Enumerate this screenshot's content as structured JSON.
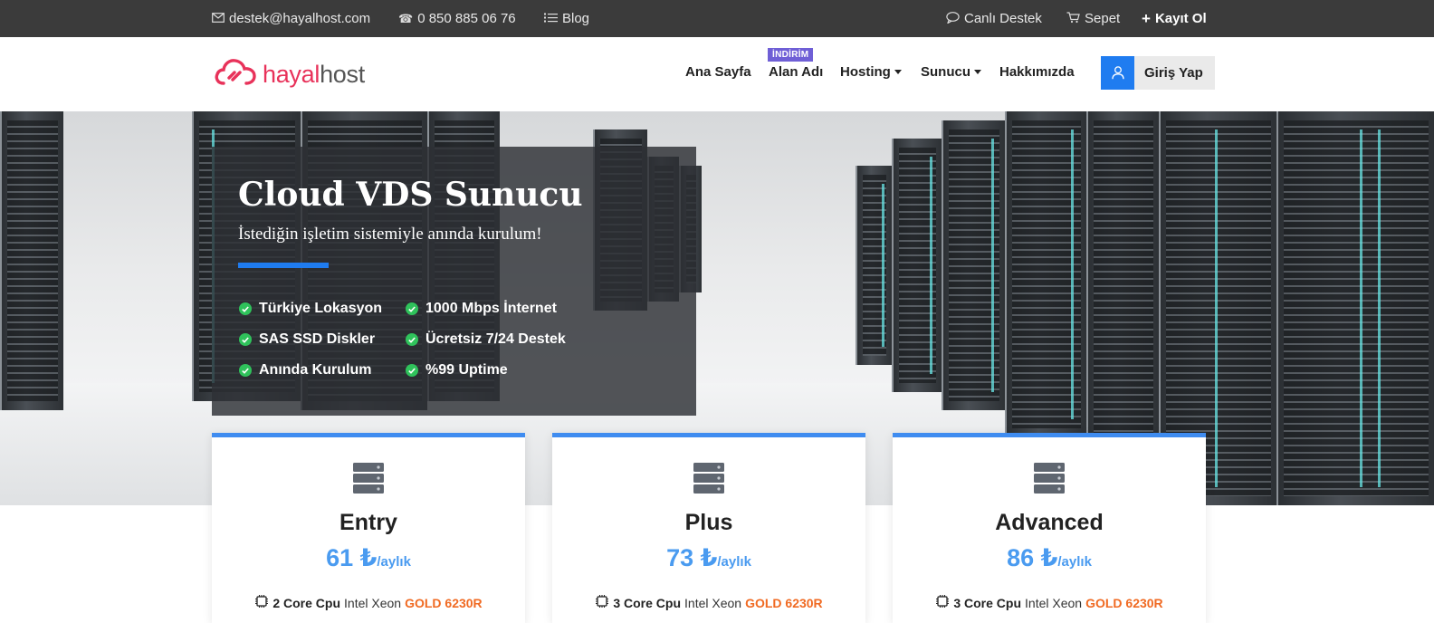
{
  "topbar": {
    "email": "destek@hayalhost.com",
    "phone": "0 850 885 06 76",
    "blog": "Blog",
    "live_support": "Canlı Destek",
    "cart": "Sepet",
    "register": "Kayıt Ol",
    "icons": [
      "mail-icon",
      "phone-icon",
      "list-icon",
      "chat-icon",
      "cart-icon",
      "plus-icon"
    ]
  },
  "header": {
    "logo_part1": "hayal",
    "logo_part2": "host",
    "nav": [
      "Ana Sayfa",
      "Alan Adı",
      "Hosting",
      "Sunucu",
      "Hakkımızda"
    ],
    "badge": "İNDİRİM",
    "login": "Giriş Yap"
  },
  "hero": {
    "title": "Cloud VDS Sunucu",
    "subtitle": "İstediğin işletim sistemiyle anında kurulum!",
    "features": [
      "Türkiye Lokasyon",
      "1000 Mbps İnternet",
      "SAS SSD Diskler",
      "Ücretsiz 7/24 Destek",
      "Anında Kurulum",
      "%99 Uptime"
    ]
  },
  "plans": [
    {
      "name": "Entry",
      "price": "61 ₺",
      "period": "/aylık",
      "cpu_bold": "2 Core Cpu",
      "cpu_text": "Intel Xeon",
      "cpu_model": "GOLD 6230R"
    },
    {
      "name": "Plus",
      "price": "73 ₺",
      "period": "/aylık",
      "cpu_bold": "3 Core Cpu",
      "cpu_text": "Intel Xeon",
      "cpu_model": "GOLD 6230R"
    },
    {
      "name": "Advanced",
      "price": "86 ₺",
      "period": "/aylık",
      "cpu_bold": "3 Core Cpu",
      "cpu_text": "Intel Xeon",
      "cpu_model": "GOLD 6230R"
    }
  ],
  "colors": {
    "topbar_bg": "#3b3b3b",
    "brand": "#e8325a",
    "accent_blue": "#1f7cf0",
    "price_blue": "#4a9bf0",
    "badge_purple": "#6f5fd6",
    "check_green": "#2fc25b",
    "gold_orange": "#f06a22"
  }
}
